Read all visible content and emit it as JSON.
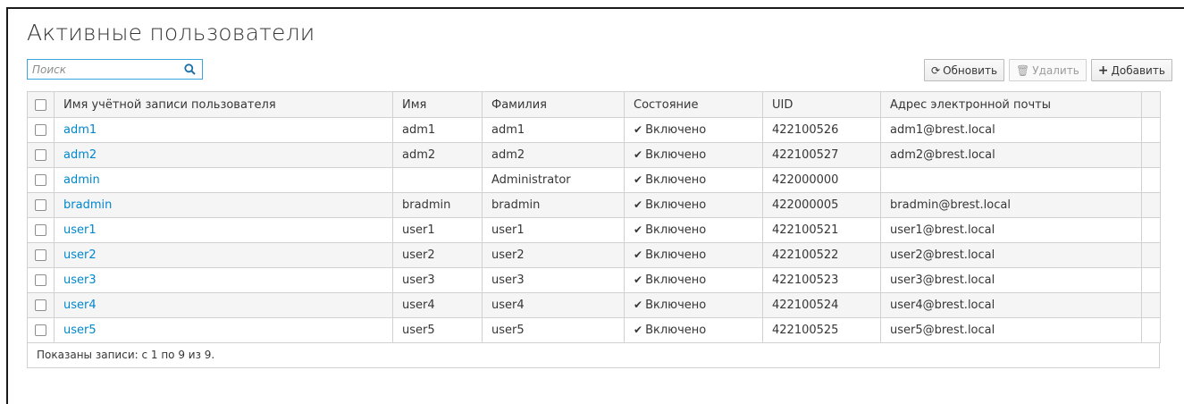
{
  "page": {
    "title": "Активные пользователи"
  },
  "search": {
    "placeholder": "Поиск",
    "value": "",
    "icon": "search-icon"
  },
  "toolbar": {
    "refresh_label": "Обновить",
    "delete_label": "Удалить",
    "add_label": "Добавить"
  },
  "table": {
    "headers": [
      "Имя учётной записи пользователя",
      "Имя",
      "Фамилия",
      "Состояние",
      "UID",
      "Адрес электронной почты"
    ],
    "rows": [
      {
        "login": "adm1",
        "first": "adm1",
        "last": "adm1",
        "state": "Включено",
        "uid": "422100526",
        "email": "adm1@brest.local"
      },
      {
        "login": "adm2",
        "first": "adm2",
        "last": "adm2",
        "state": "Включено",
        "uid": "422100527",
        "email": "adm2@brest.local"
      },
      {
        "login": "admin",
        "first": "",
        "last": "Administrator",
        "state": "Включено",
        "uid": "422000000",
        "email": ""
      },
      {
        "login": "bradmin",
        "first": "bradmin",
        "last": "bradmin",
        "state": "Включено",
        "uid": "422000005",
        "email": "bradmin@brest.local"
      },
      {
        "login": "user1",
        "first": "user1",
        "last": "user1",
        "state": "Включено",
        "uid": "422100521",
        "email": "user1@brest.local"
      },
      {
        "login": "user2",
        "first": "user2",
        "last": "user2",
        "state": "Включено",
        "uid": "422100522",
        "email": "user2@brest.local"
      },
      {
        "login": "user3",
        "first": "user3",
        "last": "user3",
        "state": "Включено",
        "uid": "422100523",
        "email": "user3@brest.local"
      },
      {
        "login": "user4",
        "first": "user4",
        "last": "user4",
        "state": "Включено",
        "uid": "422100524",
        "email": "user4@brest.local"
      },
      {
        "login": "user5",
        "first": "user5",
        "last": "user5",
        "state": "Включено",
        "uid": "422100525",
        "email": "user5@brest.local"
      }
    ]
  },
  "footer": {
    "summary": "Показаны записи: с 1 по 9 из 9."
  },
  "colors": {
    "link": "#0088ce",
    "focus_border": "#39a5dc",
    "stripe": "#f5f5f5",
    "border": "#d1d1d1"
  }
}
